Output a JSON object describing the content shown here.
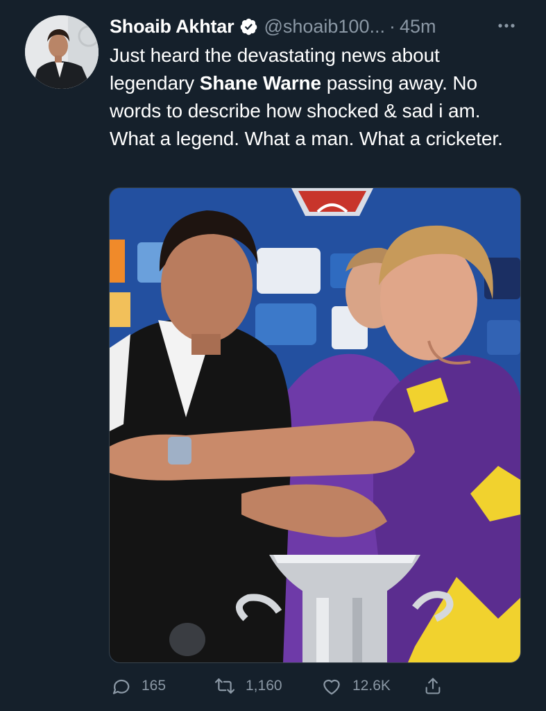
{
  "tweet": {
    "author": {
      "name": "Shoaib Akhtar",
      "handle": "@shoaib100...",
      "separator": "·",
      "time": "45m",
      "avatar_icon": "profile-photo",
      "verified_icon": "verified-badge-icon"
    },
    "text": {
      "part1": "Just heard the devastating news about legendary ",
      "bold": "Shane Warne",
      "part2": " passing away. No words to describe how shocked & sad i am. What a legend. What a man. What a cricketer."
    },
    "media": {
      "kind": "photo",
      "icon": "tweet-photo"
    },
    "actions": {
      "reply": {
        "icon": "reply-icon",
        "count": "165"
      },
      "retweet": {
        "icon": "retweet-icon",
        "count": "1,160"
      },
      "like": {
        "icon": "heart-icon",
        "count": "12.6K"
      },
      "share": {
        "icon": "share-icon"
      }
    },
    "more_icon": "more-horizontal-icon"
  },
  "colors": {
    "background": "#15202b",
    "text_primary": "#ffffff",
    "text_secondary": "#8b98a5",
    "verified_badge": "#ffffff"
  }
}
